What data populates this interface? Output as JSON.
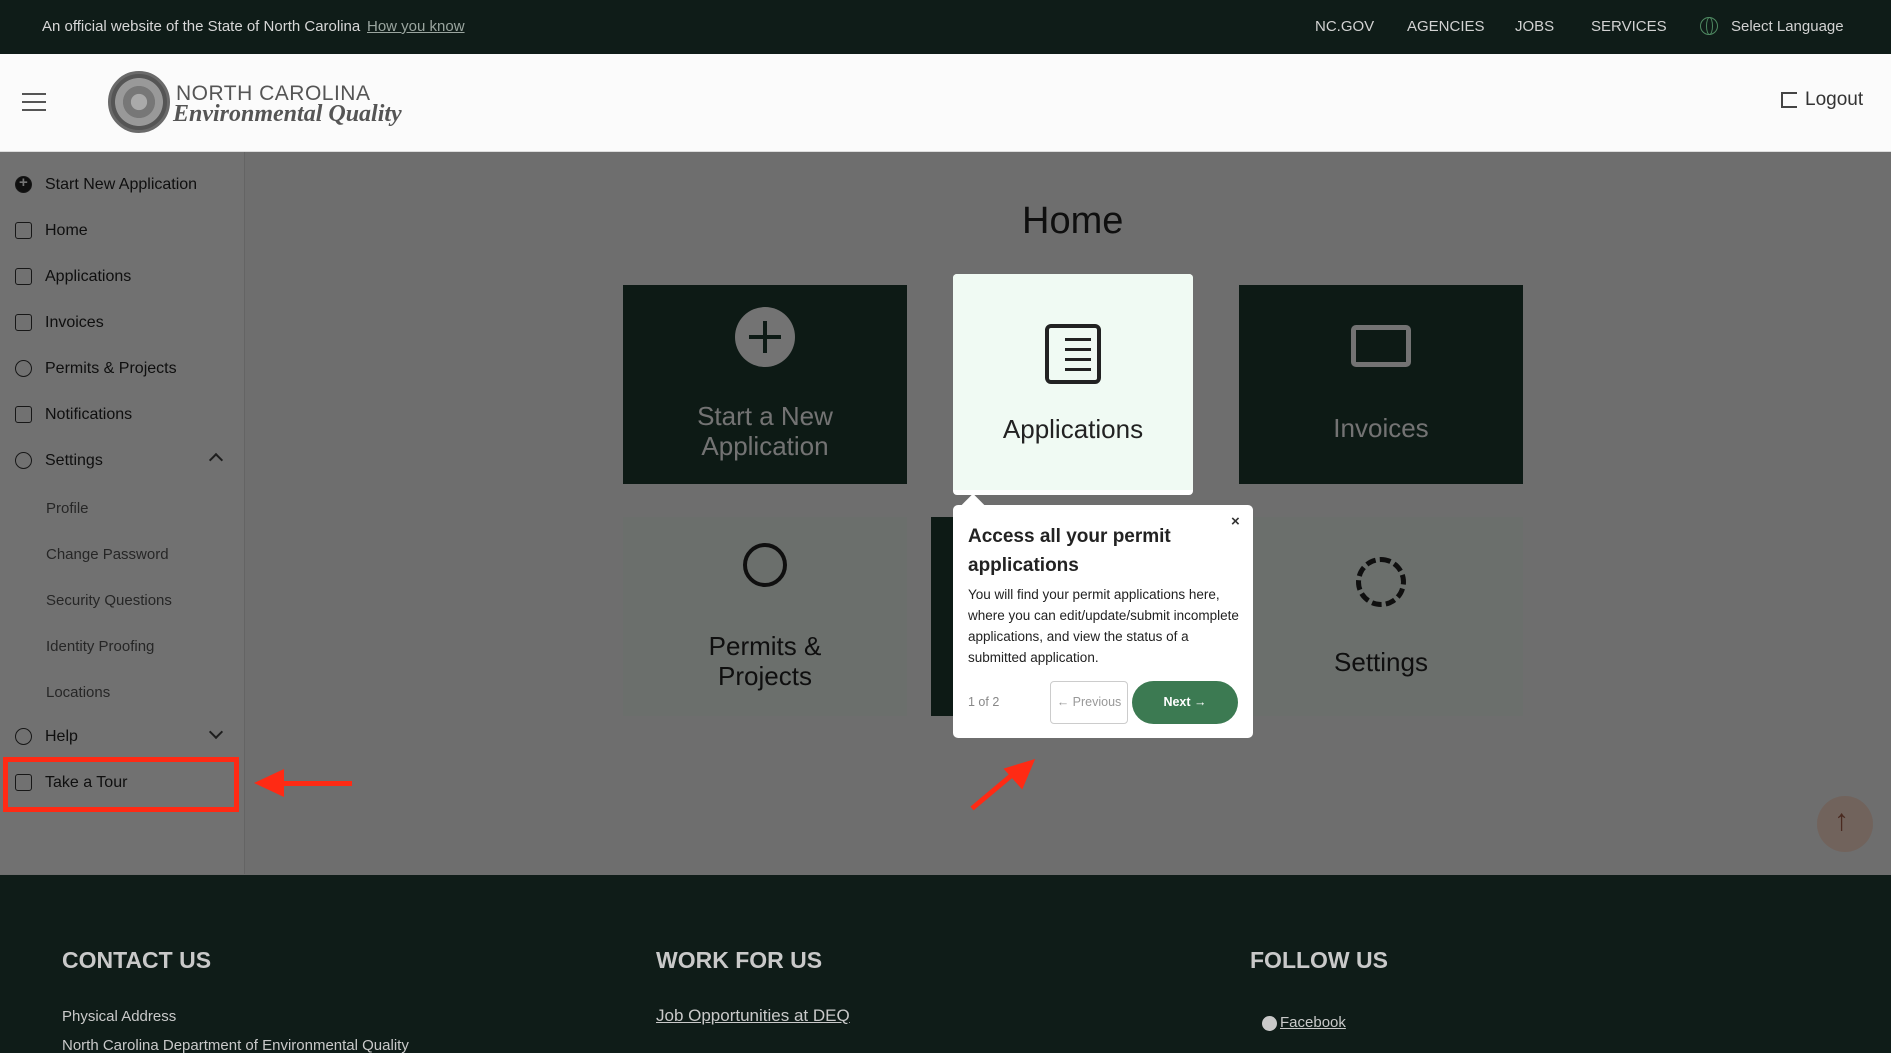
{
  "govbar": {
    "official": "An official website of the State of North Carolina",
    "how_you_know": "How you know",
    "links": [
      "NC.GOV",
      "AGENCIES",
      "JOBS",
      "SERVICES"
    ],
    "language": "Select Language"
  },
  "header": {
    "brand_line1": "NORTH CAROLINA",
    "brand_line2": "Environmental Quality",
    "logout": "Logout"
  },
  "sidebar": {
    "items": [
      {
        "label": "Start New Application",
        "icon": "plus-circle-icon"
      },
      {
        "label": "Home",
        "icon": "home-icon"
      },
      {
        "label": "Applications",
        "icon": "document-list-icon"
      },
      {
        "label": "Invoices",
        "icon": "invoice-icon"
      },
      {
        "label": "Permits & Projects",
        "icon": "award-icon"
      },
      {
        "label": "Notifications",
        "icon": "chat-icon"
      },
      {
        "label": "Settings",
        "icon": "gear-icon"
      }
    ],
    "settings_sub": [
      "Profile",
      "Change Password",
      "Security Questions",
      "Identity Proofing",
      "Locations"
    ],
    "help": "Help",
    "tour": "Take a Tour"
  },
  "main": {
    "title": "Home",
    "tiles": {
      "start": "Start a New Application",
      "applications": "Applications",
      "invoices": "Invoices",
      "permits": "Permits & Projects",
      "settings": "Settings"
    }
  },
  "popup": {
    "title": "Access all your permit applications",
    "body": "You will find your permit applications here, where you can edit/update/submit incomplete applications, and view the status of a submitted application.",
    "close": "×",
    "count": "1 of 2",
    "prev": "← Previous",
    "next": "Next →"
  },
  "footer": {
    "contact": "CONTACT US",
    "work": "WORK FOR US",
    "follow": "FOLLOW US",
    "physical": "Physical Address",
    "dept": "North Carolina Department of Environmental Quality",
    "jobs": "Job Opportunities at DEQ",
    "facebook": "Facebook"
  },
  "colors": {
    "brand_dark": "#1e3a30",
    "next_button": "#3c7a52",
    "annotation_red": "#ff2a14"
  }
}
